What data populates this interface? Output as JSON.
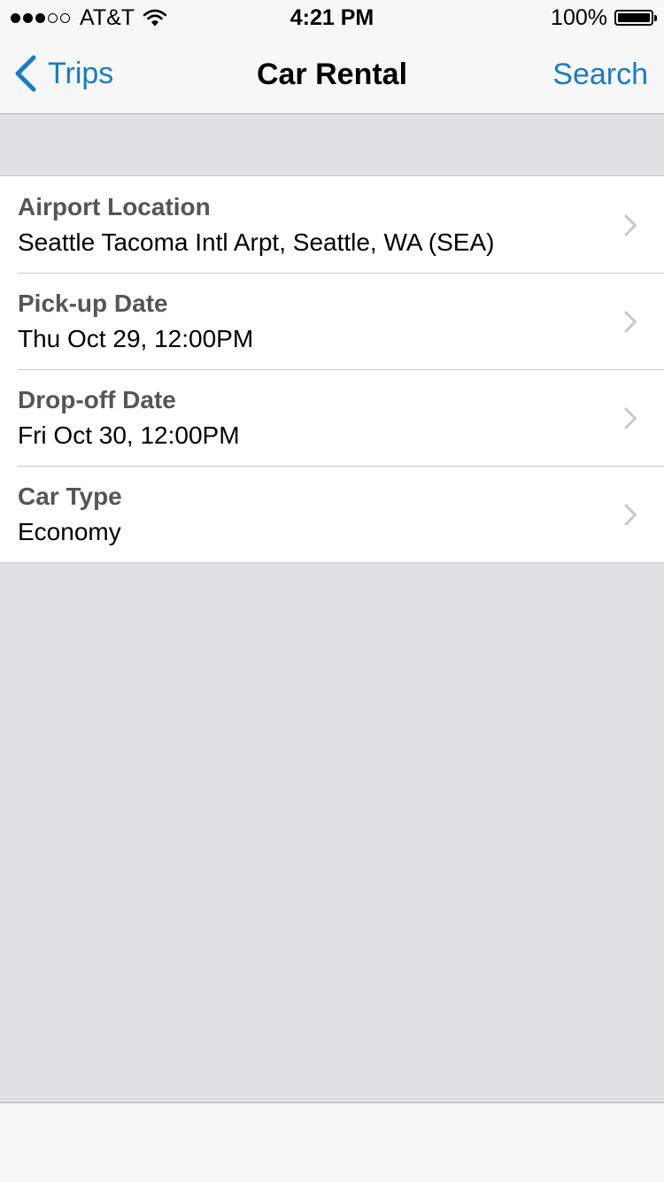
{
  "status_bar": {
    "signal_dots_filled": 3,
    "signal_dots_total": 5,
    "carrier": "AT&T",
    "time": "4:21 PM",
    "battery_percent": "100%",
    "battery_level": 1.0,
    "icons": [
      "signal-dots-icon",
      "wifi-icon",
      "battery-icon"
    ]
  },
  "nav_bar": {
    "back_label": "Trips",
    "back_icon": "chevron-left-icon",
    "title": "Car Rental",
    "search_label": "Search"
  },
  "rows": [
    {
      "label": "Airport Location",
      "value": "Seattle Tacoma Intl Arpt, Seattle, WA (SEA)"
    },
    {
      "label": "Pick-up Date",
      "value": "Thu Oct 29, 12:00PM"
    },
    {
      "label": "Drop-off Date",
      "value": "Fri Oct 30, 12:00PM"
    },
    {
      "label": "Car Type",
      "value": "Economy"
    }
  ],
  "colors": {
    "accent": "#1a7bc4",
    "background": "#e0e1e3",
    "bar": "#f7f7f7",
    "label": "#555555"
  }
}
